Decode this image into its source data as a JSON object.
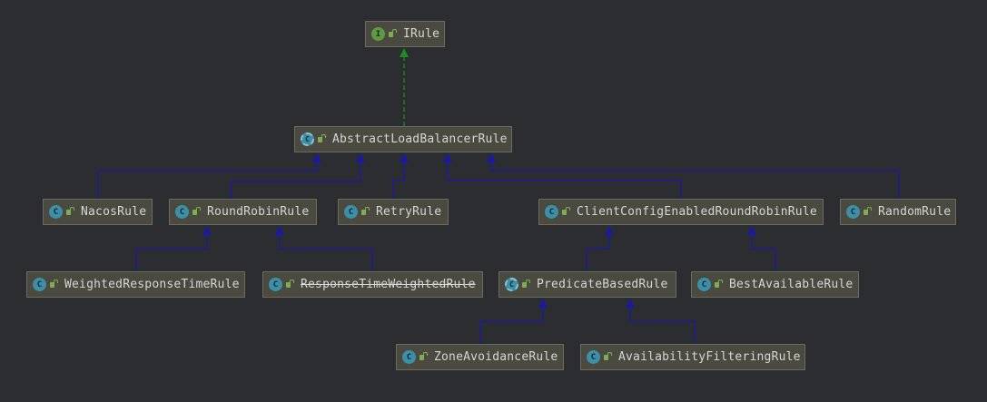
{
  "diagram": {
    "nodes": [
      {
        "id": "IRule",
        "label": "IRule",
        "kind": "interface",
        "kind_letter": "I",
        "deprecated": false
      },
      {
        "id": "AbstractLoadBalancerRule",
        "label": "AbstractLoadBalancerRule",
        "kind": "abstract",
        "kind_letter": "C",
        "deprecated": false
      },
      {
        "id": "NacosRule",
        "label": "NacosRule",
        "kind": "class",
        "kind_letter": "C",
        "deprecated": false
      },
      {
        "id": "RoundRobinRule",
        "label": "RoundRobinRule",
        "kind": "class",
        "kind_letter": "C",
        "deprecated": false
      },
      {
        "id": "RetryRule",
        "label": "RetryRule",
        "kind": "class",
        "kind_letter": "C",
        "deprecated": false
      },
      {
        "id": "ClientConfigEnabledRoundRobinRule",
        "label": "ClientConfigEnabledRoundRobinRule",
        "kind": "class",
        "kind_letter": "C",
        "deprecated": false
      },
      {
        "id": "RandomRule",
        "label": "RandomRule",
        "kind": "class",
        "kind_letter": "C",
        "deprecated": false
      },
      {
        "id": "WeightedResponseTimeRule",
        "label": "WeightedResponseTimeRule",
        "kind": "class",
        "kind_letter": "C",
        "deprecated": false
      },
      {
        "id": "ResponseTimeWeightedRule",
        "label": "ResponseTimeWeightedRule",
        "kind": "class",
        "kind_letter": "C",
        "deprecated": true
      },
      {
        "id": "PredicateBasedRule",
        "label": "PredicateBasedRule",
        "kind": "abstract",
        "kind_letter": "C",
        "deprecated": false
      },
      {
        "id": "BestAvailableRule",
        "label": "BestAvailableRule",
        "kind": "class",
        "kind_letter": "C",
        "deprecated": false
      },
      {
        "id": "ZoneAvoidanceRule",
        "label": "ZoneAvoidanceRule",
        "kind": "class",
        "kind_letter": "C",
        "deprecated": false
      },
      {
        "id": "AvailabilityFilteringRule",
        "label": "AvailabilityFilteringRule",
        "kind": "class",
        "kind_letter": "C",
        "deprecated": false
      }
    ],
    "edges": [
      {
        "from": "AbstractLoadBalancerRule",
        "to": "IRule",
        "type": "implements"
      },
      {
        "from": "NacosRule",
        "to": "AbstractLoadBalancerRule",
        "type": "extends"
      },
      {
        "from": "RoundRobinRule",
        "to": "AbstractLoadBalancerRule",
        "type": "extends"
      },
      {
        "from": "RetryRule",
        "to": "AbstractLoadBalancerRule",
        "type": "extends"
      },
      {
        "from": "ClientConfigEnabledRoundRobinRule",
        "to": "AbstractLoadBalancerRule",
        "type": "extends"
      },
      {
        "from": "RandomRule",
        "to": "AbstractLoadBalancerRule",
        "type": "extends"
      },
      {
        "from": "WeightedResponseTimeRule",
        "to": "RoundRobinRule",
        "type": "extends"
      },
      {
        "from": "ResponseTimeWeightedRule",
        "to": "RoundRobinRule",
        "type": "extends"
      },
      {
        "from": "PredicateBasedRule",
        "to": "ClientConfigEnabledRoundRobinRule",
        "type": "extends"
      },
      {
        "from": "BestAvailableRule",
        "to": "ClientConfigEnabledRoundRobinRule",
        "type": "extends"
      },
      {
        "from": "ZoneAvoidanceRule",
        "to": "PredicateBasedRule",
        "type": "extends"
      },
      {
        "from": "AvailabilityFilteringRule",
        "to": "PredicateBasedRule",
        "type": "extends"
      }
    ],
    "colors": {
      "background": "#2b2d30",
      "node_fill": "#4b4a40",
      "node_border": "#6c6b60",
      "node_text": "#d6d6d6",
      "extends_edge": "#1a1aa8",
      "implements_edge": "#1f8a1f",
      "interface_icon": "#5e9b43",
      "class_icon": "#3d8fa8"
    }
  }
}
